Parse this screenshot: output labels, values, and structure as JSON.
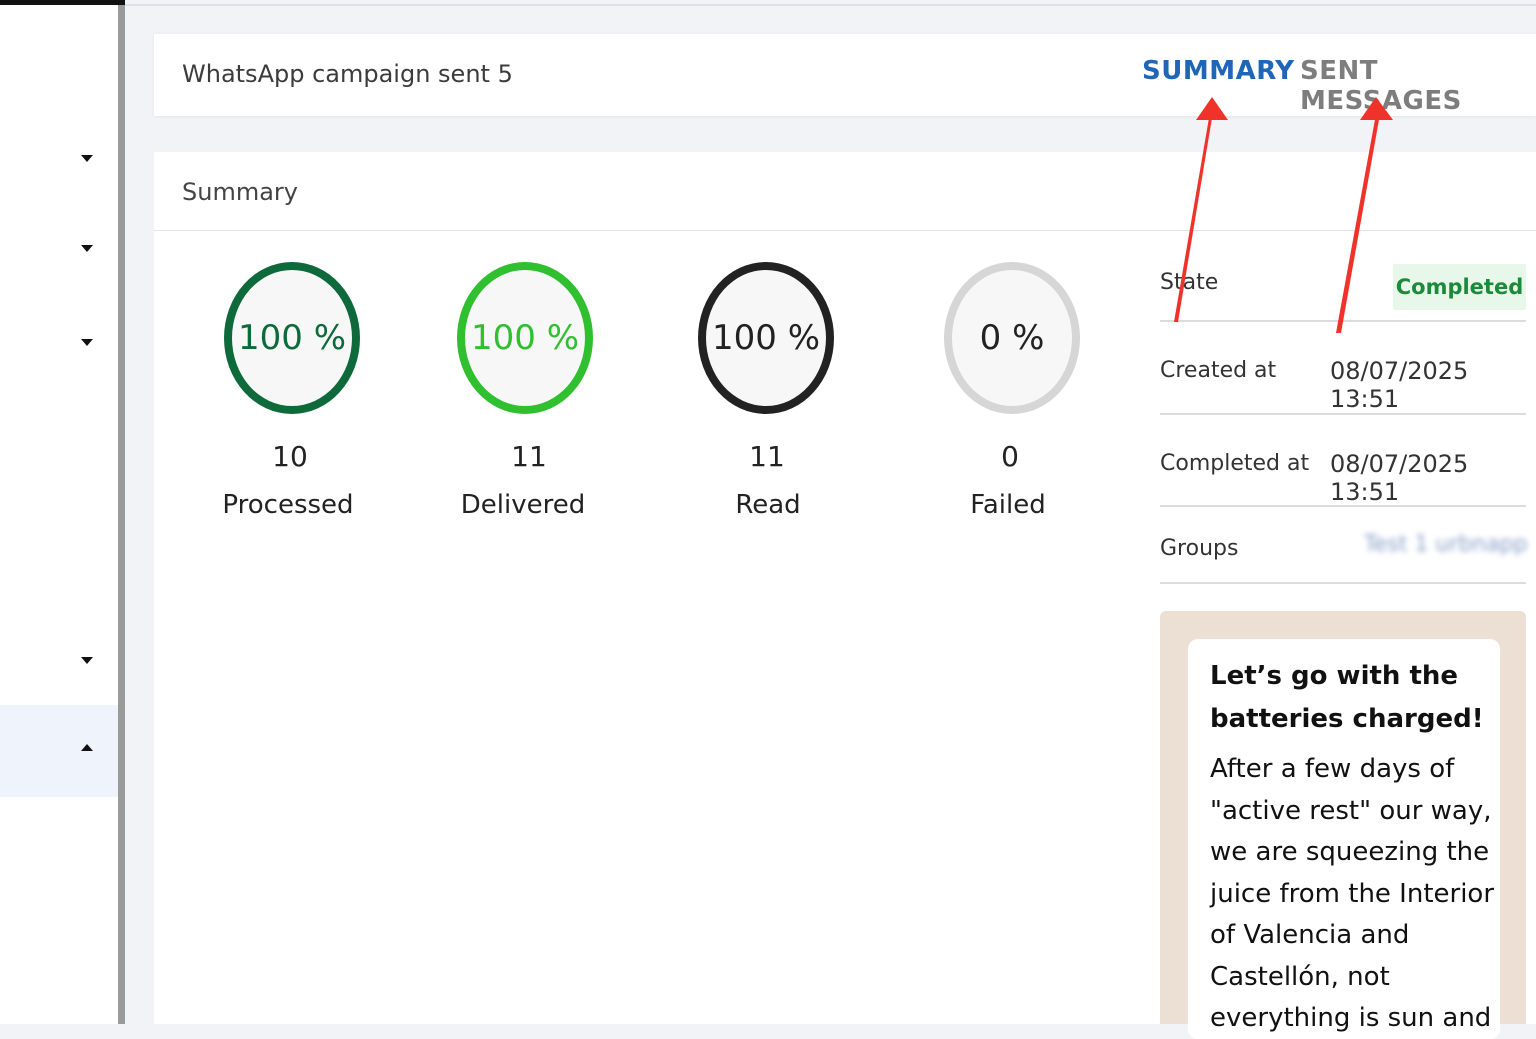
{
  "header": {
    "campaign_title": "WhatsApp campaign sent 5",
    "tabs": [
      {
        "label": "SUMMARY",
        "active": true
      },
      {
        "label": "SENT MESSAGES",
        "active": false
      }
    ]
  },
  "summary": {
    "heading": "Summary",
    "stats": [
      {
        "percent": "100 %",
        "count": "10",
        "label": "Processed",
        "color": "#0e6a3b"
      },
      {
        "percent": "100 %",
        "count": "11",
        "label": "Delivered",
        "color": "#2fbf2f"
      },
      {
        "percent": "100 %",
        "count": "11",
        "label": "Read",
        "color": "#222222"
      },
      {
        "percent": "0 %",
        "count": "0",
        "label": "Failed",
        "color": "#d6d6d6"
      }
    ]
  },
  "details": {
    "state_label": "State",
    "state_value": "Completed",
    "created_label": "Created at",
    "created_value": "08/07/2025 13:51",
    "completed_label": "Completed at",
    "completed_value": "08/07/2025 13:51",
    "groups_label": "Groups",
    "groups_value": "Test 1 urbnapp"
  },
  "message": {
    "title": "Let’s go with the batteries charged!",
    "body": "After a few days of \"active rest\" our way, we are squeezing the juice from the Interior of Valencia and Castellón, not everything is sun and"
  },
  "sidebar": {
    "items": [
      {
        "icon": "chevron-down-icon"
      },
      {
        "icon": "chevron-down-icon"
      },
      {
        "icon": "chevron-down-icon"
      },
      {
        "icon": "chevron-down-icon"
      },
      {
        "icon": "chevron-up-icon"
      }
    ]
  },
  "colors": {
    "accent": "#1f65b8",
    "annotation_arrow": "#f0332a",
    "badge_bg": "#e7f8ea",
    "badge_text": "#1b8a3a"
  }
}
